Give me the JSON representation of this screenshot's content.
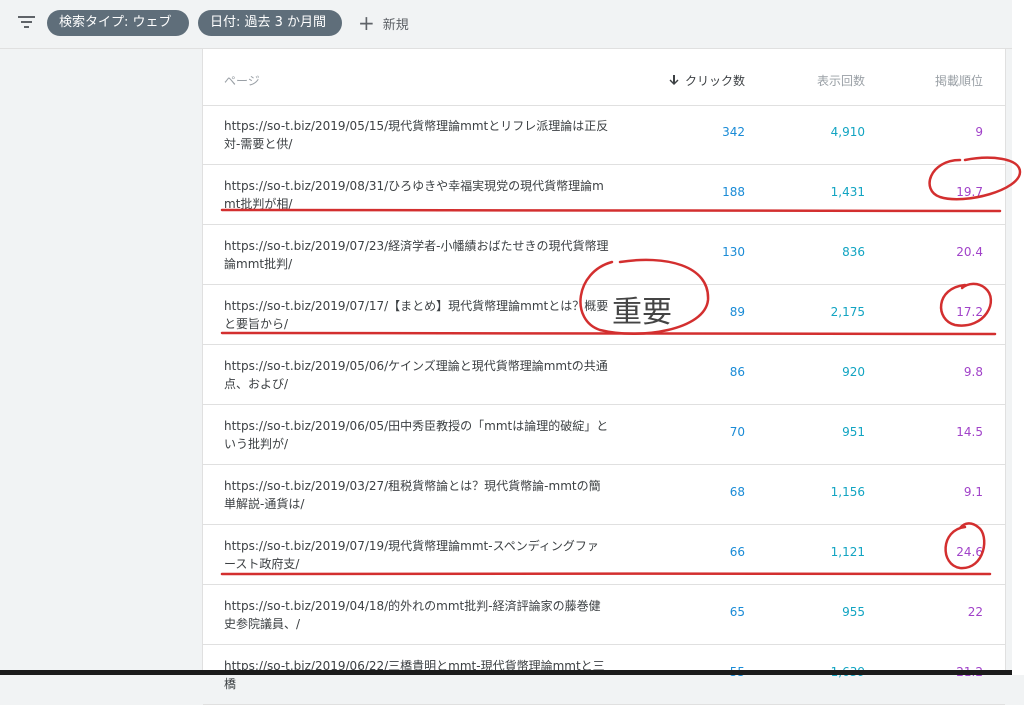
{
  "filters": {
    "chips": [
      {
        "label": "検索タイプ: ウェブ"
      },
      {
        "label": "日付: 過去 3 か月間"
      }
    ],
    "new_label": "新規"
  },
  "table": {
    "headers": {
      "page": "ページ",
      "clicks": "クリック数",
      "impressions": "表示回数",
      "position": "掲載順位"
    },
    "rows": [
      {
        "url": "https://so-t.biz/2019/05/15/現代貨幣理論mmtとリフレ派理論は正反対-需要と供/",
        "clicks": "342",
        "impressions": "4,910",
        "position": "9"
      },
      {
        "url": "https://so-t.biz/2019/08/31/ひろゆきや幸福実現党の現代貨幣理論mmt批判が相/",
        "clicks": "188",
        "impressions": "1,431",
        "position": "19.7"
      },
      {
        "url": "https://so-t.biz/2019/07/23/経済学者-小幡績おばたせきの現代貨幣理論mmt批判/",
        "clicks": "130",
        "impressions": "836",
        "position": "20.4"
      },
      {
        "url": "https://so-t.biz/2019/07/17/【まとめ】現代貨幣理論mmtとは？概要と要旨から/",
        "clicks": "89",
        "impressions": "2,175",
        "position": "17.2"
      },
      {
        "url": "https://so-t.biz/2019/05/06/ケインズ理論と現代貨幣理論mmtの共通点、および/",
        "clicks": "86",
        "impressions": "920",
        "position": "9.8"
      },
      {
        "url": "https://so-t.biz/2019/06/05/田中秀臣教授の「mmtは論理的破綻」という批判が/",
        "clicks": "70",
        "impressions": "951",
        "position": "14.5"
      },
      {
        "url": "https://so-t.biz/2019/03/27/租税貨幣論とは？現代貨幣論-mmtの簡単解説-通貨は/",
        "clicks": "68",
        "impressions": "1,156",
        "position": "9.1"
      },
      {
        "url": "https://so-t.biz/2019/07/19/現代貨幣理論mmt-スペンディングファースト政府支/",
        "clicks": "66",
        "impressions": "1,121",
        "position": "24.6"
      },
      {
        "url": "https://so-t.biz/2019/04/18/的外れのmmt批判-経済評論家の藤巻健史参院議員、/",
        "clicks": "65",
        "impressions": "955",
        "position": "22"
      },
      {
        "url": "https://so-t.biz/2019/06/22/三橋貴明とmmt-現代貨幣理論mmtと三橋",
        "clicks": "55",
        "impressions": "1,639",
        "position": "21.2"
      }
    ]
  },
  "annotation": {
    "handwritten_text": "重要",
    "color": "#d32f2f"
  },
  "colors": {
    "clicks": "#1a8bd6",
    "impressions": "#12a4c2",
    "position": "#a142c9",
    "chip": "#5f6e7a"
  }
}
